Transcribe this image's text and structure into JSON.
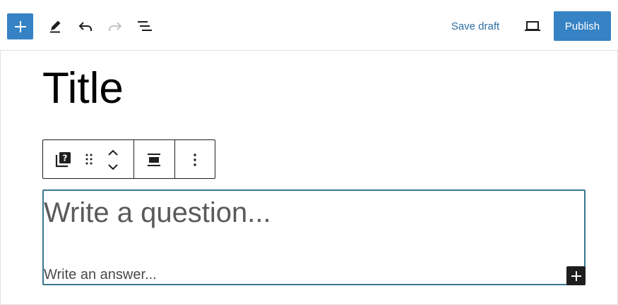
{
  "topbar": {
    "icons": {
      "inserter": "plus-icon",
      "tools": "pencil-icon",
      "undo": "undo-icon",
      "redo": "redo-icon",
      "outline": "list-view-icon",
      "preview": "laptop-icon"
    },
    "save_draft_label": "Save draft",
    "publish_label": "Publish"
  },
  "editor": {
    "title": "Title",
    "block_toolbar": {
      "icons": [
        "faq-block-icon",
        "drag-handle-icon",
        "chevron-up-icon",
        "chevron-down-icon",
        "align-icon",
        "more-options-icon"
      ]
    },
    "faq": {
      "question_placeholder": "Write a question...",
      "answer_placeholder": "Write an answer..."
    }
  },
  "colors": {
    "accent": "#3582c4",
    "save_draft": "#2b6ea3",
    "block_border": "#3a7791",
    "dark": "#1e1e1e",
    "redo_disabled": "#c3c4c7"
  }
}
